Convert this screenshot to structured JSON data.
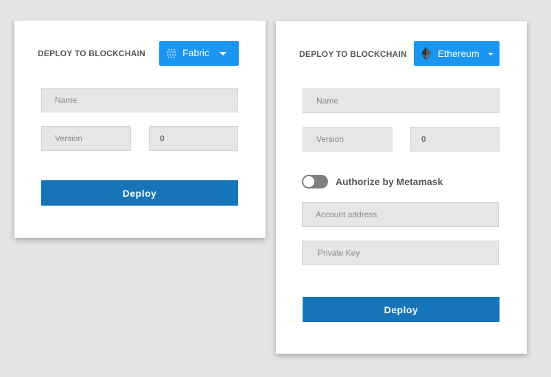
{
  "fabric_card": {
    "title": "DEPLOY TO BLOCKCHAIN",
    "dropdown": {
      "label": "Fabric",
      "icon": "fabric-icon"
    },
    "name_placeholder": "Name",
    "version_placeholder": "Version",
    "version_value": "0",
    "deploy_label": "Deploy"
  },
  "eth_card": {
    "title": "DEPLOY TO BLOCKCHAIN",
    "dropdown": {
      "label": "Ethereum",
      "icon": "ethereum-icon"
    },
    "name_placeholder": "Name",
    "version_placeholder": "Version",
    "version_value": "0",
    "toggle_label": "Authorize by Metamask",
    "toggle_on": false,
    "account_placeholder": "Account address",
    "private_key_placeholder": "Private Key",
    "deploy_label": "Deploy"
  },
  "colors": {
    "dropdown": "#1a96f0",
    "deploy_button": "#1674b8",
    "field_bg": "#e6e6e6",
    "toggle_off": "#808080"
  }
}
